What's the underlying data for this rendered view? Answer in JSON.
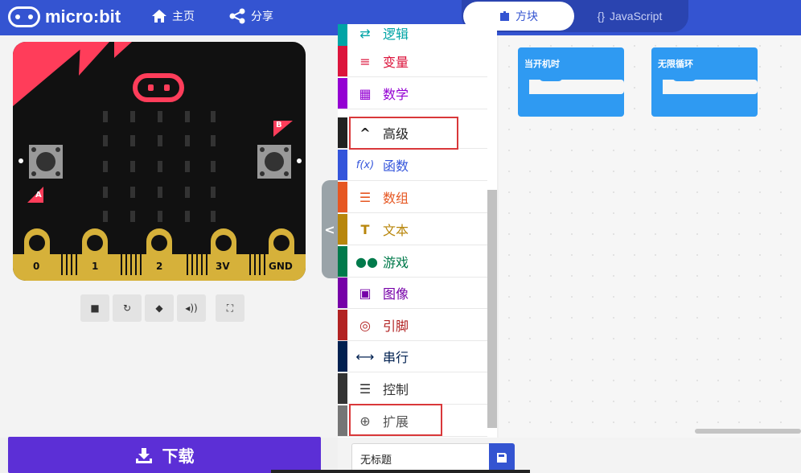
{
  "header": {
    "logo_text": "micro:bit",
    "home_label": "主页",
    "share_label": "分享",
    "blocks_tab": "方块",
    "js_tab": "JavaScript",
    "js_tab_prefix": "{}"
  },
  "toolbox": {
    "categories": [
      {
        "label": "逻辑",
        "icon": "logic-icon",
        "color": "#00a4a6"
      },
      {
        "label": "变量",
        "icon": "variables-icon",
        "color": "#dc143c"
      },
      {
        "label": "数学",
        "icon": "math-icon",
        "color": "#9400d3"
      },
      {
        "label": "高级",
        "icon": "chevron-up-icon",
        "color": "#212121"
      },
      {
        "label": "函数",
        "icon": "function-icon",
        "color": "#3455db"
      },
      {
        "label": "数组",
        "icon": "array-icon",
        "color": "#e65722"
      },
      {
        "label": "文本",
        "icon": "text-icon",
        "color": "#b8860b"
      },
      {
        "label": "游戏",
        "icon": "gamepad-icon",
        "color": "#007a4b"
      },
      {
        "label": "图像",
        "icon": "image-icon",
        "color": "#7600a8"
      },
      {
        "label": "引脚",
        "icon": "pins-icon",
        "color": "#b22222"
      },
      {
        "label": "串行",
        "icon": "usb-icon",
        "color": "#002050"
      },
      {
        "label": "控制",
        "icon": "control-icon",
        "color": "#333333"
      },
      {
        "label": "扩展",
        "icon": "plus-circle-icon",
        "color": "#757575"
      }
    ]
  },
  "board": {
    "pin_labels": [
      "0",
      "1",
      "2",
      "3V",
      "GND"
    ],
    "button_a": "A",
    "button_b": "B"
  },
  "workspace": {
    "on_start": "当开机时",
    "forever": "无限循环"
  },
  "download_label": "下载",
  "project_name": "无标题"
}
